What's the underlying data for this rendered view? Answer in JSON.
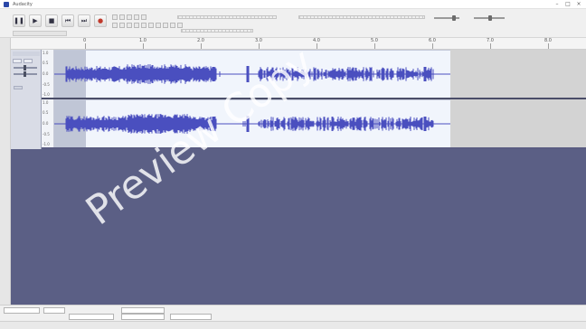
{
  "window": {
    "title": "Audacity"
  },
  "toolbar": {
    "transport": [
      {
        "name": "pause-button",
        "glyph": "❚❚"
      },
      {
        "name": "play-button",
        "glyph": "▶"
      },
      {
        "name": "stop-button",
        "glyph": "■"
      },
      {
        "name": "skip-start-button",
        "glyph": "⏮"
      },
      {
        "name": "skip-end-button",
        "glyph": "⏭"
      },
      {
        "name": "record-button",
        "glyph": "●"
      }
    ]
  },
  "ruler": {
    "labels": [
      "0",
      "1.0",
      "2.0",
      "3.0",
      "4.0",
      "5.0",
      "6.0",
      "7.0",
      "8.0"
    ]
  },
  "track": {
    "scale": [
      "1.0",
      "0.5",
      "0.0",
      "-0.5",
      "-1.0"
    ]
  },
  "watermark": {
    "text": "Preview Copy"
  },
  "colors": {
    "waveform": "#4a4fbf",
    "trackBackground": "#f1f5fc",
    "emptyArea": "#5b5f85",
    "selection": "#c0c6d6"
  }
}
